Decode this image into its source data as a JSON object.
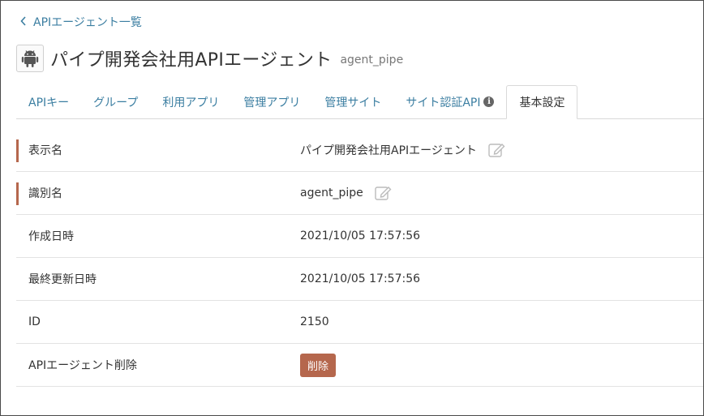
{
  "breadcrumb": {
    "back_label": "APIエージェント一覧"
  },
  "header": {
    "title": "パイプ開発会社用APIエージェント",
    "subtitle": "agent_pipe",
    "icon": "android-icon"
  },
  "tabs": [
    {
      "label": "APIキー"
    },
    {
      "label": "グループ"
    },
    {
      "label": "利用アプリ"
    },
    {
      "label": "管理アプリ"
    },
    {
      "label": "管理サイト"
    },
    {
      "label": "サイト認証API",
      "icon": "info-icon"
    },
    {
      "label": "基本設定",
      "active": true
    }
  ],
  "settings": {
    "display_name": {
      "label": "表示名",
      "value": "パイプ開発会社用APIエージェント"
    },
    "identifier": {
      "label": "識別名",
      "value": "agent_pipe"
    },
    "created_at": {
      "label": "作成日時",
      "value": "2021/10/05 17:57:56"
    },
    "updated_at": {
      "label": "最終更新日時",
      "value": "2021/10/05 17:57:56"
    },
    "id": {
      "label": "ID",
      "value": "2150"
    },
    "delete": {
      "label": "APIエージェント削除",
      "button_label": "削除"
    }
  },
  "colors": {
    "link": "#3b7ea1",
    "accent": "#b5674d",
    "border": "#d9d9d9"
  }
}
